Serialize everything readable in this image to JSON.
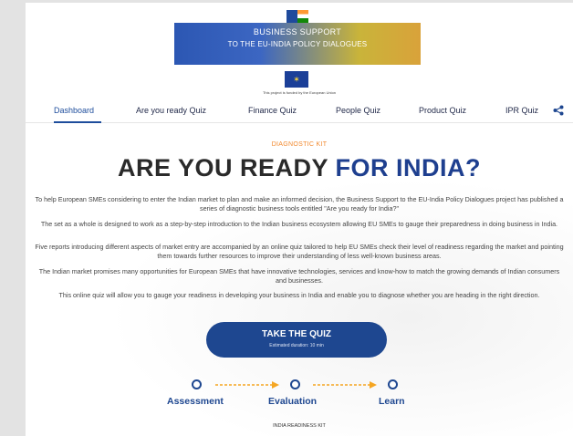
{
  "header": {
    "banner_line1": "BUSINESS SUPPORT",
    "banner_line2": "TO THE EU-INDIA POLICY DIALOGUES",
    "eu_note": "This project is funded by the European Union"
  },
  "nav": {
    "items": [
      {
        "label": "Dashboard"
      },
      {
        "label": "Are you ready Quiz"
      },
      {
        "label": "Finance Quiz"
      },
      {
        "label": "People Quiz"
      },
      {
        "label": "Product Quiz"
      },
      {
        "label": "IPR Quiz"
      }
    ],
    "share_icon": "share-icon"
  },
  "content": {
    "kit_label": "DIAGNOSTIC KIT",
    "headline_part1": "ARE YOU READY",
    "headline_part2": "FOR INDIA?",
    "paragraphs": [
      "To help European SMEs considering to enter the Indian market to plan and make an informed decision, the Business Support to the EU-India Policy Dialogues project has published a series of diagnostic business tools entitled \"Are you ready for India?\"",
      "The set as a whole is designed to work as a step-by-step introduction to the Indian business ecosystem allowing EU SMEs to gauge their preparedness in doing business in India.",
      "Five reports introducing different aspects of market entry are accompanied by an online quiz tailored to help EU SMEs check their level of readiness regarding the market and pointing them towards further resources to improve their understanding of less well-known business areas.",
      "The Indian market promises many opportunities for European SMEs that have innovative technologies, services and know-how to match the growing demands of Indian consumers and businesses.",
      "This online quiz will allow you to gauge your readiness in developing your business in India and enable you to diagnose whether you are heading in the right direction."
    ],
    "cta_title": "TAKE THE QUIZ",
    "cta_sub": "Estimated duration: 10 min",
    "steps": [
      "Assessment",
      "Evaluation",
      "Learn"
    ],
    "bottom_label": "INDIA READINESS KIT"
  },
  "colors": {
    "primary": "#1e4790",
    "accent": "#f2892e",
    "arrow": "#f5a623"
  }
}
